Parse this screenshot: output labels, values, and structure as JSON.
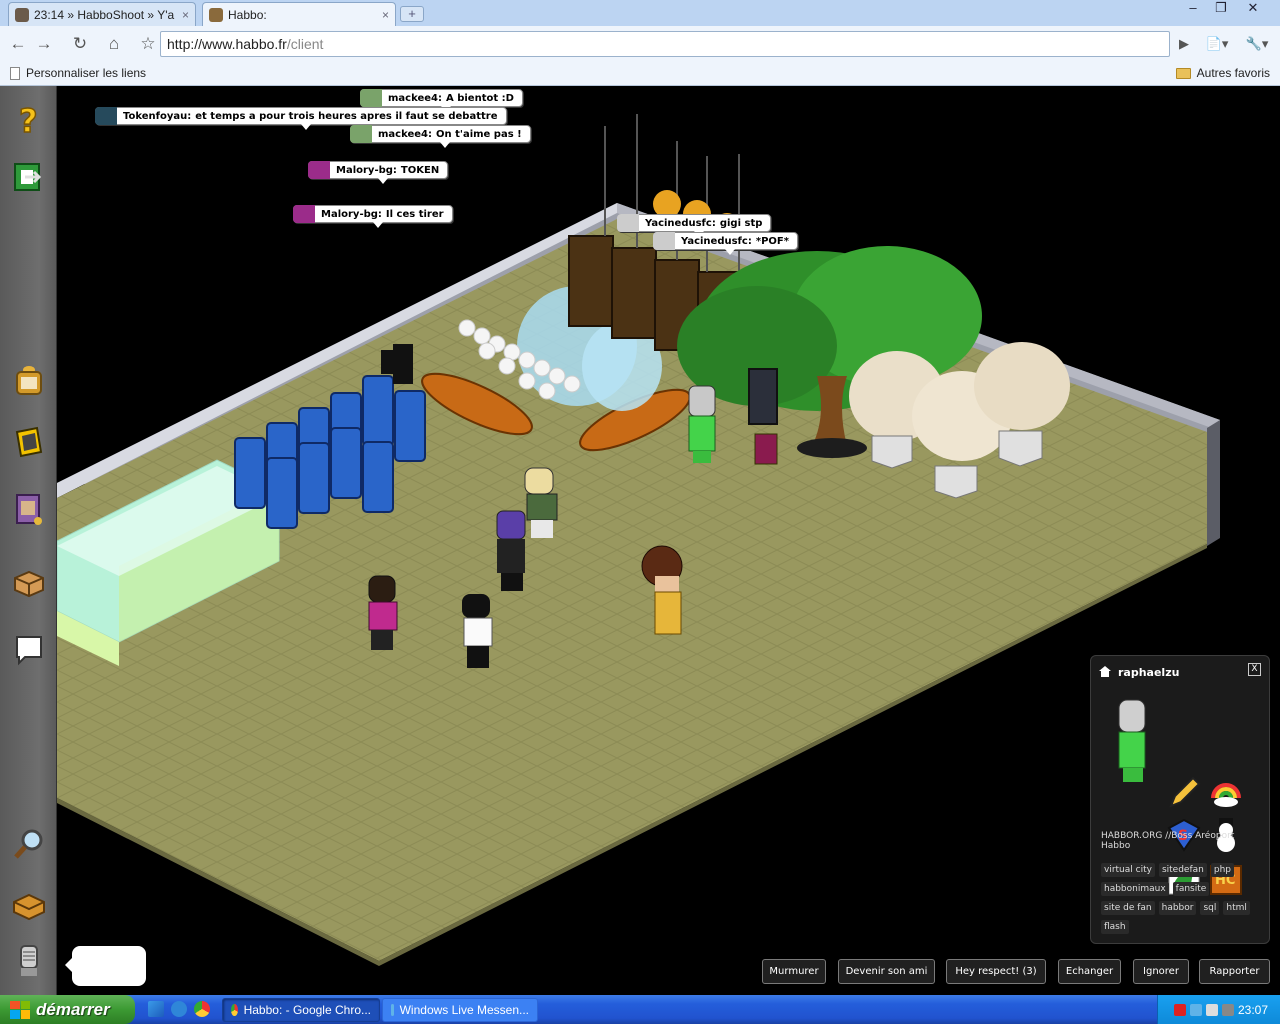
{
  "browser": {
    "tabs": [
      {
        "label": "23:14 » HabboShoot » Y'a ...",
        "close": "×",
        "active": false
      },
      {
        "label": "Habbo:",
        "close": "×",
        "active": true
      }
    ],
    "new_tab": "+",
    "window_controls": [
      "–",
      "❐",
      "✕"
    ],
    "nav": {
      "back": "←",
      "forward": "→",
      "reload": "↻",
      "home": "⌂",
      "star": "☆"
    },
    "url_host": "http://www.habbo.fr",
    "url_path": "/client",
    "toolbar_right": [
      "▶",
      "📄▾",
      "🔧▾"
    ],
    "bookmarks_left": "Personnaliser les liens",
    "bookmarks_right": "Autres favoris"
  },
  "sidebar": {
    "buttons": [
      "help-icon",
      "exit-room-icon",
      "habbo-club-icon",
      "navigator-icon",
      "catalog-icon",
      "inventory-icon",
      "messenger-icon",
      "search-icon",
      "room-box-icon",
      "avatar-icon"
    ]
  },
  "chat": [
    {
      "user": "mackee4",
      "text": "A bientot :D",
      "color": "#7aa36a"
    },
    {
      "user": "Tokenfoyau",
      "text": "et temps a pour trois heures apres il faut se debattre",
      "color": "#264a5c"
    },
    {
      "user": "mackee4",
      "text": "On t'aime pas !",
      "color": "#7aa36a"
    },
    {
      "user": "Malory-bg",
      "text": "TOKEN",
      "color": "#9b2c8a"
    },
    {
      "user": "Malory-bg",
      "text": "Il ces tirer",
      "color": "#9b2c8a"
    },
    {
      "user": "Yacinedusfc",
      "text": "gigi stp",
      "color": "#cccccc"
    },
    {
      "user": "Yacinedusfc",
      "text": "*POF*",
      "color": "#cccccc"
    }
  ],
  "info_panel": {
    "username": "raphaelzu",
    "close": "X",
    "motto": "HABBOR.ORG //Boss Aréoport Habbo",
    "badges": [
      "pencil-badge",
      "rainbow-badge",
      "superman-badge",
      "snowman-badge",
      "dragon-badge",
      "hc-badge"
    ],
    "tags": [
      "virtual city",
      "sitedefan",
      "php",
      "habbonimaux",
      "fansite",
      "site de fan",
      "habbor",
      "sql",
      "html",
      "flash"
    ]
  },
  "actions": [
    "Murmurer",
    "Devenir son ami",
    "Hey respect! (3)",
    "Echanger",
    "Ignorer",
    "Rapporter"
  ],
  "taskbar": {
    "start": "démarrer",
    "items": [
      {
        "label": "Habbo: - Google Chro...",
        "active": true
      },
      {
        "label": "Windows Live Messen...",
        "active": false
      }
    ],
    "clock": "23:07"
  }
}
